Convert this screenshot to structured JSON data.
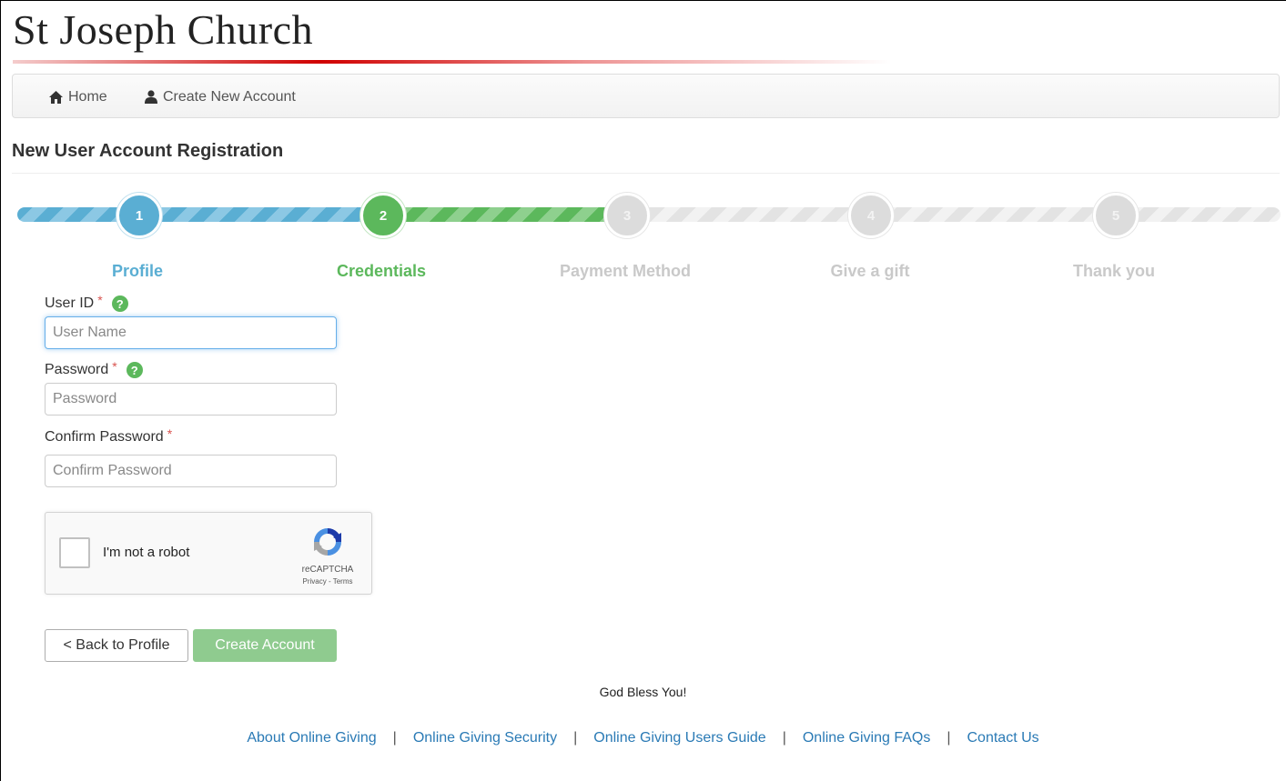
{
  "site": {
    "title": "St Joseph Church"
  },
  "nav": {
    "home_label": "Home",
    "create_label": "Create New Account"
  },
  "page": {
    "heading": "New User Account Registration"
  },
  "wizard": {
    "steps": [
      {
        "number": "1",
        "label": "Profile",
        "state": "completed",
        "color": "#5aaed3"
      },
      {
        "number": "2",
        "label": "Credentials",
        "state": "active",
        "color": "#5cb85c"
      },
      {
        "number": "3",
        "label": "Payment Method",
        "state": "pending",
        "color": "#c9c9c9"
      },
      {
        "number": "4",
        "label": "Give a gift",
        "state": "pending",
        "color": "#c9c9c9"
      },
      {
        "number": "5",
        "label": "Thank you",
        "state": "pending",
        "color": "#c9c9c9"
      }
    ]
  },
  "form": {
    "user_id": {
      "label": "User ID",
      "required": "*",
      "placeholder": "User Name",
      "value": ""
    },
    "password": {
      "label": "Password",
      "required": "*",
      "placeholder": "Password",
      "value": ""
    },
    "confirm_password": {
      "label": "Confirm Password",
      "required": "*",
      "placeholder": "Confirm Password",
      "value": ""
    },
    "help_icon": "?"
  },
  "recaptcha": {
    "label": "I'm not a robot",
    "brand": "reCAPTCHA",
    "links": "Privacy - Terms"
  },
  "buttons": {
    "back": "< Back to Profile",
    "create": "Create Account"
  },
  "footer": {
    "message": "God Bless You!",
    "links": [
      "About Online Giving",
      "Online Giving Security",
      "Online Giving Users Guide",
      "Online Giving FAQs",
      "Contact Us"
    ],
    "separator": "|"
  },
  "colors": {
    "accent_blue": "#5aaed3",
    "accent_green": "#5cb85c",
    "link": "#2a7ab5",
    "required": "#d9534f"
  }
}
